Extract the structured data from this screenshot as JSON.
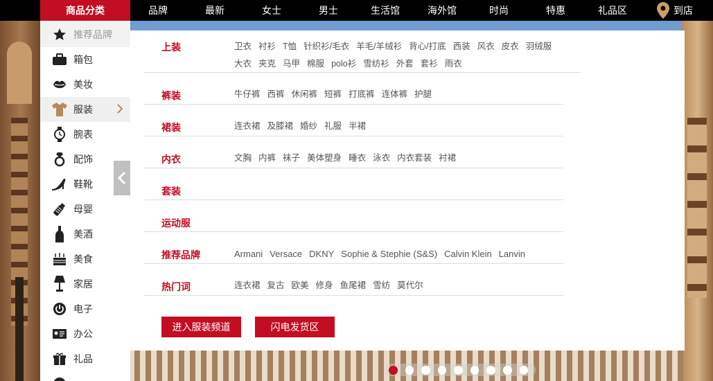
{
  "nav": {
    "category_title": "商品分类",
    "items": [
      "品牌",
      "最新",
      "女士",
      "男士",
      "生活馆",
      "海外馆",
      "时尚",
      "特惠",
      "礼品区"
    ],
    "store_label": "到店"
  },
  "sidebar": {
    "items": [
      {
        "label": "推荐品牌",
        "icon": "star-icon"
      },
      {
        "label": "箱包",
        "icon": "briefcase-icon"
      },
      {
        "label": "美妆",
        "icon": "lips-icon"
      },
      {
        "label": "服装",
        "icon": "shirt-icon"
      },
      {
        "label": "腕表",
        "icon": "watch-icon"
      },
      {
        "label": "配饰",
        "icon": "ring-icon"
      },
      {
        "label": "鞋靴",
        "icon": "heel-shoe-icon"
      },
      {
        "label": "母婴",
        "icon": "baby-bottle-icon"
      },
      {
        "label": "美酒",
        "icon": "wine-bottle-icon"
      },
      {
        "label": "美食",
        "icon": "cake-icon"
      },
      {
        "label": "家居",
        "icon": "lamp-icon"
      },
      {
        "label": "电子",
        "icon": "power-icon"
      },
      {
        "label": "办公",
        "icon": "id-card-icon"
      },
      {
        "label": "礼品",
        "icon": "gift-icon"
      }
    ]
  },
  "panel": {
    "rows": [
      {
        "title": "上装",
        "links": [
          "卫衣",
          "衬衫",
          "T恤",
          "针织衫/毛衣",
          "羊毛/羊绒衫",
          "背心/打底",
          "西装",
          "风衣",
          "皮衣",
          "羽绒服",
          "大衣",
          "夹克",
          "马甲",
          "棉服",
          "polo衫",
          "雪纺衫",
          "外套",
          "套衫",
          "雨衣"
        ]
      },
      {
        "title": "裤装",
        "links": [
          "牛仔裤",
          "西裤",
          "休闲裤",
          "短裤",
          "打底裤",
          "连体裤",
          "护腿"
        ]
      },
      {
        "title": "裙装",
        "links": [
          "连衣裙",
          "及膝裙",
          "婚纱",
          "礼服",
          "半裙"
        ]
      },
      {
        "title": "内衣",
        "links": [
          "文胸",
          "内裤",
          "袜子",
          "美体塑身",
          "睡衣",
          "泳衣",
          "内衣套装",
          "衬裙"
        ]
      },
      {
        "title": "套装",
        "links": []
      },
      {
        "title": "运动服",
        "links": []
      },
      {
        "title": "推荐品牌",
        "links": [
          "Armani",
          "Versace",
          "DKNY",
          "Sophie & Stephie (S&S)",
          "Calvin Klein",
          "Lanvin"
        ]
      },
      {
        "title": "热门词",
        "links": [
          "连衣裙",
          "复古",
          "欧美",
          "修身",
          "鱼尾裙",
          "雪纺",
          "莫代尔"
        ]
      }
    ],
    "buttons": {
      "enter_channel": "进入服装频道",
      "flash_delivery": "闪电发货区"
    }
  },
  "carousel": {
    "total": 9,
    "active": 1
  },
  "colors": {
    "accent": "#c30d23",
    "nav_bg": "#000000"
  }
}
